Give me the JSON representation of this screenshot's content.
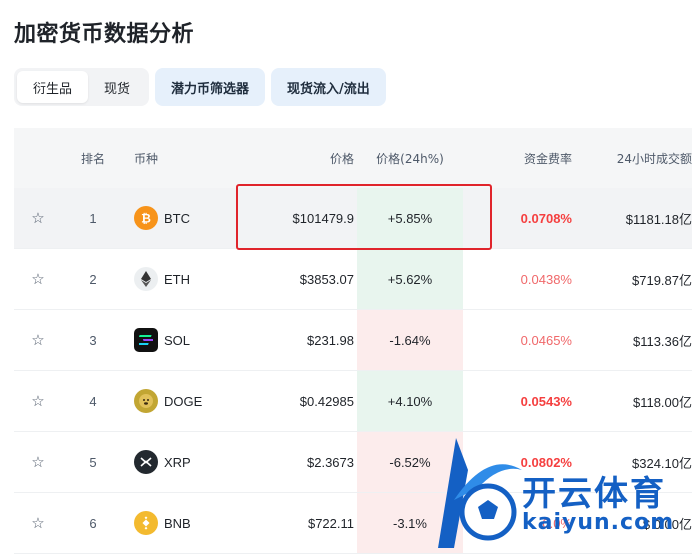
{
  "page": {
    "title": "加密货币数据分析"
  },
  "toolbar": {
    "seg_derivatives": "衍生品",
    "seg_spot": "现货",
    "btn_potential": "潜力币筛选器",
    "btn_spot_flow": "现货流入/流出"
  },
  "table": {
    "headers": {
      "rank": "排名",
      "coin": "币种",
      "price": "价格",
      "change": "价格(24h%)",
      "funding": "资金费率",
      "volume": "24小时成交额"
    },
    "rows": [
      {
        "rank": "1",
        "coin": "BTC",
        "price": "$101479.9",
        "change": "+5.85%",
        "funding": "0.0708%",
        "volume": "$1181.18亿"
      },
      {
        "rank": "2",
        "coin": "ETH",
        "price": "$3853.07",
        "change": "+5.62%",
        "funding": "0.0438%",
        "volume": "$719.87亿"
      },
      {
        "rank": "3",
        "coin": "SOL",
        "price": "$231.98",
        "change": "-1.64%",
        "funding": "0.0465%",
        "volume": "$113.36亿"
      },
      {
        "rank": "4",
        "coin": "DOGE",
        "price": "$0.42985",
        "change": "+4.10%",
        "funding": "0.0543%",
        "volume": "$118.00亿"
      },
      {
        "rank": "5",
        "coin": "XRP",
        "price": "$2.3673",
        "change": "-6.52%",
        "funding": "0.0802%",
        "volume": "$324.10亿"
      },
      {
        "rank": "6",
        "coin": "BNB",
        "price": "$722.11",
        "change": "-3.1%",
        "funding": "0.0%",
        "volume": "$ 0.00亿"
      }
    ]
  },
  "watermark": {
    "title": "开云体育",
    "url": "kaiyun.com"
  },
  "colors": {
    "up_bg": "#e8f5ee",
    "down_bg": "#fcecec",
    "funding_red": "#f53f3f",
    "highlight_red": "#e0242b",
    "pill_bg": "#e6f0fb",
    "watermark_blue": "#1460c4"
  },
  "icons": [
    "star-icon",
    "btc-icon",
    "eth-icon",
    "sol-icon",
    "doge-icon",
    "xrp-icon",
    "bnb-icon"
  ]
}
